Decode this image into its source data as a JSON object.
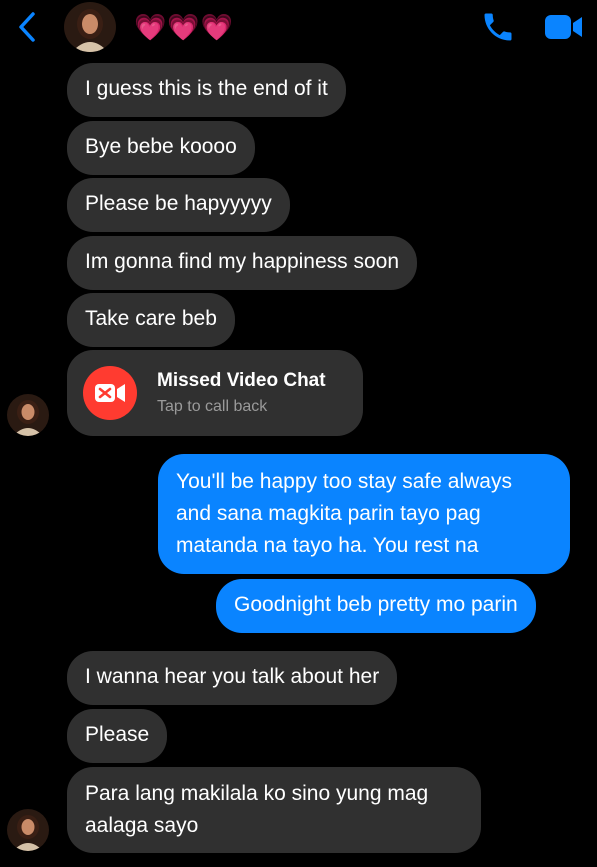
{
  "header": {
    "title": "💗💗💗",
    "accent": "#0a84ff"
  },
  "messages": [
    {
      "text": "I guess this is the end of it"
    },
    {
      "text": "Bye bebe koooo"
    },
    {
      "text": "Please be hapyyyyy"
    },
    {
      "text": "Im gonna find my happiness soon"
    },
    {
      "text": "Take care beb"
    },
    {
      "text": "You'll be happy too stay safe always"
    },
    {
      "text": "and sana magkita parin tayo pag"
    },
    {
      "text": "matanda na tayo ha. You rest na"
    },
    {
      "text": "Goodnight beb pretty mo parin"
    },
    {
      "text": "I wanna hear you talk about her"
    },
    {
      "text": "Please"
    },
    {
      "text": "Para lang makilala ko sino yung mag"
    },
    {
      "text": "aalaga sayo"
    }
  ],
  "missed_call": {
    "title": "Missed Video Chat",
    "subtitle": "Tap to call back",
    "color": "#ff3b30"
  },
  "colors": {
    "incoming_bubble": "#303030",
    "outgoing_bubble": "#0a84ff",
    "background": "#000000"
  },
  "icons": {
    "back": "chevron-left-icon",
    "call": "phone-icon",
    "video": "video-camera-icon",
    "missed": "missed-video-icon"
  }
}
